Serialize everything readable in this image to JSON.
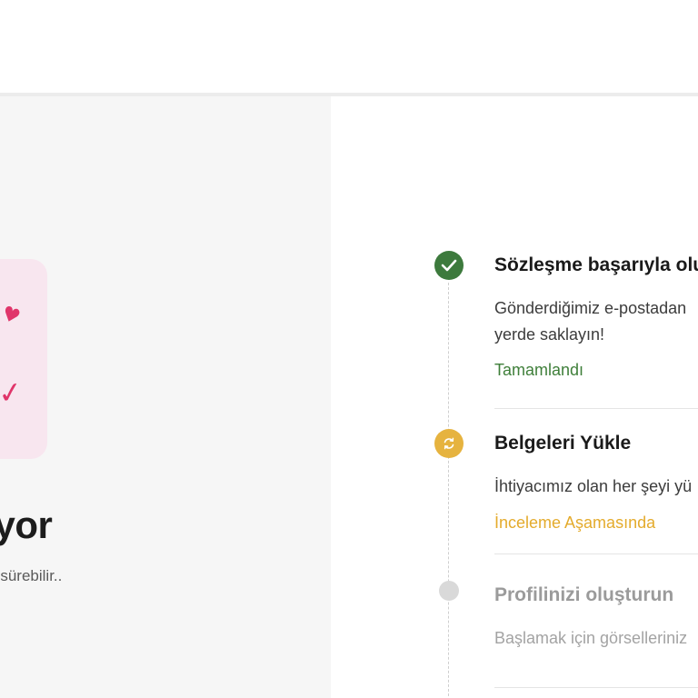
{
  "left": {
    "title": "ulanıyor",
    "subtitle": "üne kadar sürebilir.."
  },
  "steps": [
    {
      "title": "Sözleşme başarıyla olu",
      "desc_line1": "Gönderdiğimiz e-postadan",
      "desc_line2": "yerde saklayın!",
      "status": "Tamamlandı",
      "icon": "checkmark-icon",
      "color": "#3d7a3d"
    },
    {
      "title": "Belgeleri Yükle",
      "desc_line1": "İhtiyacımız olan her şeyi yü",
      "status": "İnceleme Aşamasında",
      "icon": "refresh-icon",
      "color": "#e6b33f"
    },
    {
      "title": "Profilinizi oluşturun",
      "desc_line1": "Başlamak için görselleriniz",
      "icon": "pending-dot-icon",
      "color": "#d9d9d9"
    }
  ]
}
